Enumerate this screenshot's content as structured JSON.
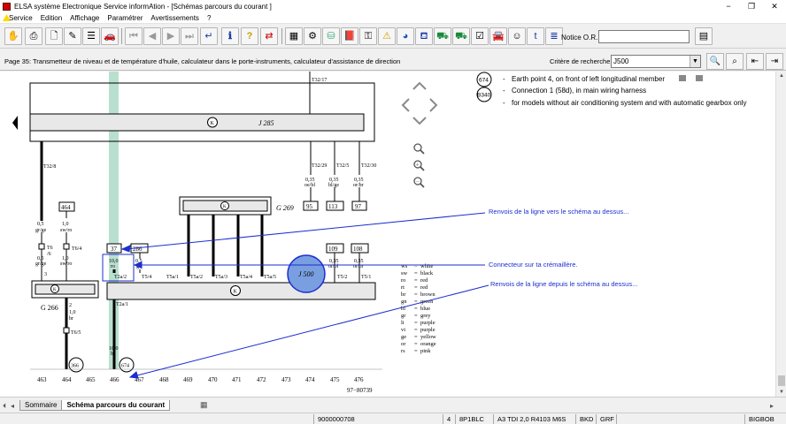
{
  "window": {
    "title": "ELSA système Electronique Service informAtion - [Schémas parcours du courant ]"
  },
  "menu": [
    "Service",
    "Edition",
    "Affichage",
    "Paramétrer",
    "Avertissements",
    "?"
  ],
  "toolbar": {
    "notice_label": "Notice O.R.:",
    "notice_value": ""
  },
  "page": {
    "title": "Page 35: Transmetteur de niveau et de température d'huile, calculateur dans le porte-instruments, calculateur d'assistance de direction",
    "criteria_label": "Critère de recherche:",
    "criteria_value": "J500"
  },
  "legend_top": [
    {
      "badge": "674",
      "text": "Earth point 4, on front of left longitudinal member"
    },
    {
      "badge": "B340",
      "text": "Connection 1 (58d), in main wiring harness"
    },
    {
      "badge": "",
      "text": "for models without air conditioning system and with automatic gearbox only"
    }
  ],
  "components": {
    "j285": "J 285",
    "g269": "G 269",
    "j500": "J 500",
    "g266": "G 266"
  },
  "connectors": {
    "t32_17": "T32/17",
    "t32_8": "T32/8",
    "t32_29": "T32/29",
    "t32_5": "T32/5",
    "t32_30": "T32/30",
    "t6": "T6",
    "t6_6": "/6",
    "t6_4": "T6/4",
    "t6_3": "3",
    "t6_5": "T6/5",
    "t2": "2",
    "t2a_2": "T2a/2",
    "t5_4": "T5/4",
    "t5a_1": "T5a/1",
    "t5a_2": "T5a/2",
    "t5a_3": "T5a/3",
    "t5a_4": "T5a/4",
    "t5a_5": "T5a/5",
    "t5_2": "T5/2",
    "t5_1": "T5/1",
    "t2a_1": "T2a/1"
  },
  "wires": {
    "w1": [
      "0,5",
      "gr/ge"
    ],
    "w2": [
      "1,0",
      "sw/ro"
    ],
    "w3": [
      "1,0",
      "sw/ro"
    ],
    "w4": [
      "0,5",
      "gr/ge"
    ],
    "w5": [
      "1,0",
      "br"
    ],
    "w6": [
      "10,0",
      "ro"
    ],
    "w7": [
      "0,5",
      "ge"
    ],
    "w8": [
      "10,0",
      "br"
    ],
    "w9": [
      "0,35",
      "oe/bl"
    ],
    "w10": [
      "0,35",
      "bl/ge"
    ],
    "w11": [
      "0,35",
      "or/br"
    ],
    "w12": [
      "0,35",
      "or/bl"
    ],
    "w13": [
      "0,35",
      "or/br"
    ]
  },
  "refs": {
    "r95": "95",
    "r113": "113",
    "r97": "97",
    "r464": "464",
    "r37": "37",
    "r286": "286",
    "r109": "109",
    "r108": "108",
    "r366": "366",
    "r674": "674"
  },
  "coords": [
    "463",
    "464",
    "465",
    "466",
    "467",
    "468",
    "469",
    "470",
    "471",
    "472",
    "473",
    "474",
    "475",
    "476"
  ],
  "figure_id": "97−80739",
  "color_legend": [
    [
      "ws",
      "white"
    ],
    [
      "sw",
      "black"
    ],
    [
      "ro",
      "red"
    ],
    [
      "rt",
      "red"
    ],
    [
      "br",
      "brown"
    ],
    [
      "gn",
      "green"
    ],
    [
      "bl",
      "blue"
    ],
    [
      "gr",
      "grey"
    ],
    [
      "li",
      "purple"
    ],
    [
      "vi",
      "purple"
    ],
    [
      "ge",
      "yellow"
    ],
    [
      "or",
      "orange"
    ],
    [
      "rs",
      "pink"
    ]
  ],
  "annotations": {
    "a1": "Renvois de la ligne vers le schéma au dessus...",
    "a2": "Connecteur sur ta crémaillère.",
    "a3": "Renvois de la ligne depuis le schéma au dessus..."
  },
  "tabs": [
    "Sommaire",
    "Schéma parcours du courant"
  ],
  "status": {
    "s1": "9000000708",
    "s2": "4",
    "s3": "8P1BLC",
    "s4": "A3 TDI 2,0 R4103 M6S",
    "s5": "BKD",
    "s6": "GRF",
    "s7": "BIGBOB"
  },
  "colors": {
    "highlight": "#b9e0cf",
    "annotation": "#1d2ecf"
  }
}
